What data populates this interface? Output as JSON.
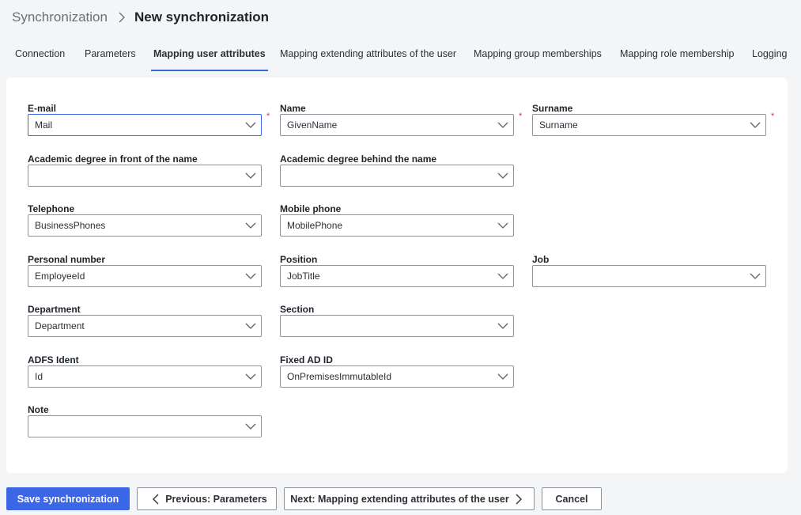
{
  "breadcrumb": {
    "parent": "Synchronization",
    "current": "New synchronization"
  },
  "tabs": [
    {
      "label": "Connection"
    },
    {
      "label": "Parameters"
    },
    {
      "label": "Mapping user attributes"
    },
    {
      "label": "Mapping extending attributes of the user"
    },
    {
      "label": "Mapping group memberships"
    },
    {
      "label": "Mapping role membership"
    },
    {
      "label": "Logging"
    }
  ],
  "active_tab": "Mapping user attributes",
  "fields": {
    "email": {
      "label": "E-mail",
      "value": "Mail",
      "required": "*"
    },
    "name": {
      "label": "Name",
      "value": "GivenName",
      "required": "*"
    },
    "surname": {
      "label": "Surname",
      "value": "Surname",
      "required": "*"
    },
    "degree_front": {
      "label": "Academic degree in front of the name",
      "value": ""
    },
    "degree_behind": {
      "label": "Academic degree behind the name",
      "value": ""
    },
    "telephone": {
      "label": "Telephone",
      "value": "BusinessPhones"
    },
    "mobile": {
      "label": "Mobile phone",
      "value": "MobilePhone"
    },
    "personal_number": {
      "label": "Personal number",
      "value": "EmployeeId"
    },
    "position": {
      "label": "Position",
      "value": "JobTitle"
    },
    "job": {
      "label": "Job",
      "value": ""
    },
    "department": {
      "label": "Department",
      "value": "Department"
    },
    "section": {
      "label": "Section",
      "value": ""
    },
    "adfs": {
      "label": "ADFS Ident",
      "value": "Id"
    },
    "fixed_ad": {
      "label": "Fixed AD ID",
      "value": "OnPremisesImmutableId"
    },
    "note": {
      "label": "Note",
      "value": ""
    }
  },
  "buttons": {
    "save": "Save synchronization",
    "previous": "Previous: Parameters",
    "next": "Next: Mapping extending attributes of the user",
    "cancel": "Cancel"
  },
  "colors": {
    "accent": "#3b66e8",
    "required": "#d63b3b",
    "background": "#f4f5f7"
  },
  "icons": {
    "breadcrumb_separator": "chevron-right-icon",
    "select": "chevron-down-icon",
    "previous": "chevron-left-icon",
    "next": "chevron-right-icon"
  }
}
